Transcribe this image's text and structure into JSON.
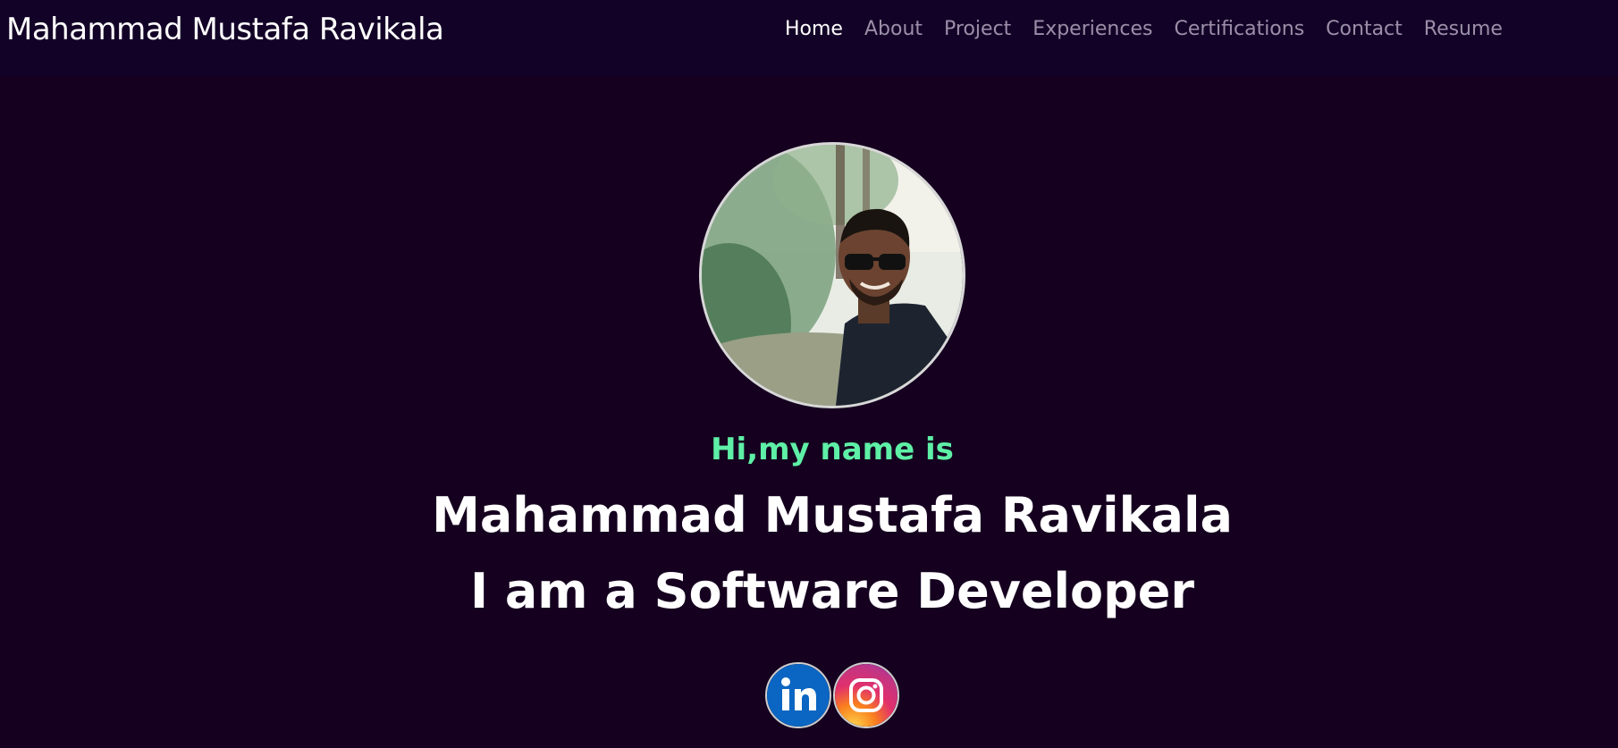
{
  "nav": {
    "brand": "Mahammad Mustafa Ravikala",
    "links": [
      "Home",
      "About",
      "Project",
      "Experiences",
      "Certifications",
      "Contact",
      "Resume"
    ],
    "active_link": "Home"
  },
  "hero": {
    "greeting": "Hi,my name is",
    "name": "Mahammad Mustafa Ravikala",
    "role": "I am a Software Developer",
    "avatar_alt": "profile photo",
    "socials": [
      {
        "name": "linkedin",
        "icon": "linkedin-icon",
        "color": "#0a66c2"
      },
      {
        "name": "instagram",
        "icon": "instagram-icon",
        "color": "#e1306c"
      }
    ]
  },
  "colors": {
    "background": "#15011f",
    "navbar": "#130227",
    "accent": "#5ef0a6",
    "nav_inactive": "#9a8fa8"
  }
}
